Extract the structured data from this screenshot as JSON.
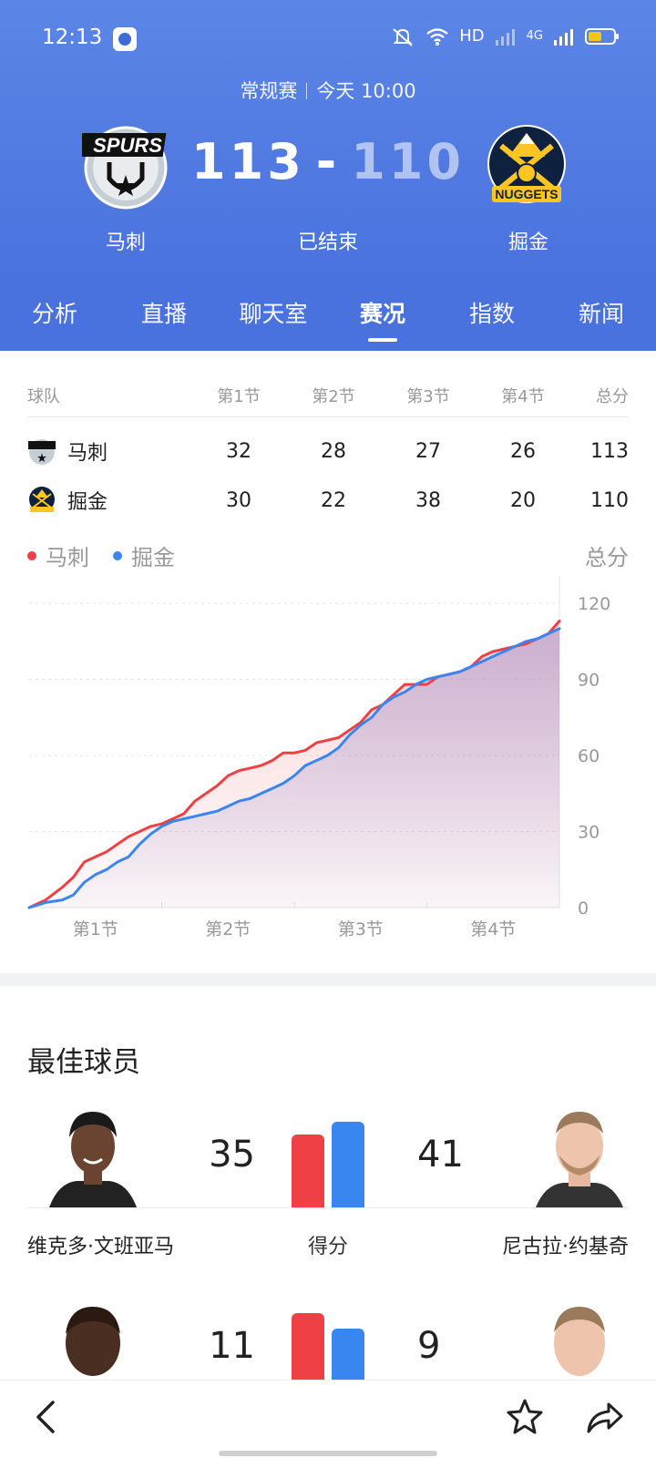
{
  "status_bar": {
    "time": "12:13",
    "network": "HD",
    "signal_4g": "4G"
  },
  "game": {
    "meta_type": "常规赛",
    "meta_time": "今天 10:00",
    "status": "已结束",
    "home": {
      "name": "马刺",
      "score": "113",
      "logo_text": "SPURS"
    },
    "away": {
      "name": "掘金",
      "score": "110",
      "logo_text": "NUGGETS"
    },
    "dash": "-"
  },
  "tabs": [
    "分析",
    "直播",
    "聊天室",
    "赛况",
    "指数",
    "新闻"
  ],
  "active_tab": "赛况",
  "score_table": {
    "headers": [
      "球队",
      "第1节",
      "第2节",
      "第3节",
      "第4节",
      "总分"
    ],
    "rows": [
      {
        "team": "马刺",
        "q": [
          "32",
          "28",
          "27",
          "26"
        ],
        "total": "113"
      },
      {
        "team": "掘金",
        "q": [
          "30",
          "22",
          "38",
          "20"
        ],
        "total": "110"
      }
    ]
  },
  "legend": {
    "home": "马刺",
    "away": "掘金",
    "total_label": "总分"
  },
  "colors": {
    "home": "#ee4045",
    "away": "#3a86f0",
    "header": "#4a72de"
  },
  "chart_data": {
    "type": "line",
    "ylim": [
      0,
      120
    ],
    "y_ticks": [
      "0",
      "30",
      "60",
      "90",
      "120"
    ],
    "x_labels": [
      "第1节",
      "第2节",
      "第3节",
      "第4节"
    ],
    "xlim": [
      0,
      48
    ],
    "series": [
      {
        "name": "马刺",
        "color": "#ee4045",
        "points": [
          [
            0,
            0
          ],
          [
            1.5,
            3
          ],
          [
            3,
            8
          ],
          [
            4,
            12
          ],
          [
            5,
            18
          ],
          [
            6,
            20
          ],
          [
            7,
            22
          ],
          [
            8,
            25
          ],
          [
            9,
            28
          ],
          [
            10,
            30
          ],
          [
            11,
            32
          ],
          [
            12,
            33
          ],
          [
            13,
            35
          ],
          [
            14,
            37
          ],
          [
            15,
            42
          ],
          [
            16,
            45
          ],
          [
            17,
            48
          ],
          [
            18,
            52
          ],
          [
            19,
            54
          ],
          [
            20,
            55
          ],
          [
            21,
            56
          ],
          [
            22,
            58
          ],
          [
            23,
            61
          ],
          [
            24,
            61
          ],
          [
            25,
            62
          ],
          [
            26,
            65
          ],
          [
            27,
            66
          ],
          [
            28,
            67
          ],
          [
            29,
            70
          ],
          [
            30,
            73
          ],
          [
            31,
            78
          ],
          [
            32,
            80
          ],
          [
            33,
            84
          ],
          [
            34,
            88
          ],
          [
            35,
            88
          ],
          [
            36,
            88
          ],
          [
            37,
            91
          ],
          [
            38,
            92
          ],
          [
            39,
            93
          ],
          [
            40,
            95
          ],
          [
            41,
            99
          ],
          [
            42,
            101
          ],
          [
            43,
            102
          ],
          [
            44,
            103
          ],
          [
            45,
            104
          ],
          [
            46,
            106
          ],
          [
            47,
            108
          ],
          [
            48,
            113
          ]
        ]
      },
      {
        "name": "掘金",
        "color": "#3a86f0",
        "points": [
          [
            0,
            0
          ],
          [
            1.5,
            2
          ],
          [
            3,
            3
          ],
          [
            4,
            5
          ],
          [
            5,
            10
          ],
          [
            6,
            13
          ],
          [
            7,
            15
          ],
          [
            8,
            18
          ],
          [
            9,
            20
          ],
          [
            10,
            25
          ],
          [
            11,
            29
          ],
          [
            12,
            32
          ],
          [
            13,
            34
          ],
          [
            14,
            35
          ],
          [
            15,
            36
          ],
          [
            16,
            37
          ],
          [
            17,
            38
          ],
          [
            18,
            40
          ],
          [
            19,
            42
          ],
          [
            20,
            43
          ],
          [
            21,
            45
          ],
          [
            22,
            47
          ],
          [
            23,
            49
          ],
          [
            24,
            52
          ],
          [
            25,
            56
          ],
          [
            26,
            58
          ],
          [
            27,
            60
          ],
          [
            28,
            63
          ],
          [
            29,
            68
          ],
          [
            30,
            72
          ],
          [
            31,
            75
          ],
          [
            32,
            80
          ],
          [
            33,
            83
          ],
          [
            34,
            85
          ],
          [
            35,
            88
          ],
          [
            36,
            90
          ],
          [
            37,
            91
          ],
          [
            38,
            92
          ],
          [
            39,
            93
          ],
          [
            40,
            95
          ],
          [
            41,
            97
          ],
          [
            42,
            99
          ],
          [
            43,
            101
          ],
          [
            44,
            103
          ],
          [
            45,
            105
          ],
          [
            46,
            106
          ],
          [
            47,
            108
          ],
          [
            48,
            110
          ]
        ]
      }
    ]
  },
  "best_players": {
    "title": "最佳球员",
    "rows": [
      {
        "stat": "得分",
        "home_player": "维克多·文班亚马",
        "home_value": 35,
        "away_player": "尼古拉·约基奇",
        "away_value": 41,
        "home_label": "35",
        "away_label": "41"
      },
      {
        "stat": "",
        "home_player": "",
        "home_value": 11,
        "away_player": "",
        "away_value": 9,
        "home_label": "11",
        "away_label": "9"
      }
    ]
  },
  "icons": {
    "back": "chevron-left-icon",
    "favorite": "star-icon",
    "share": "share-icon"
  }
}
